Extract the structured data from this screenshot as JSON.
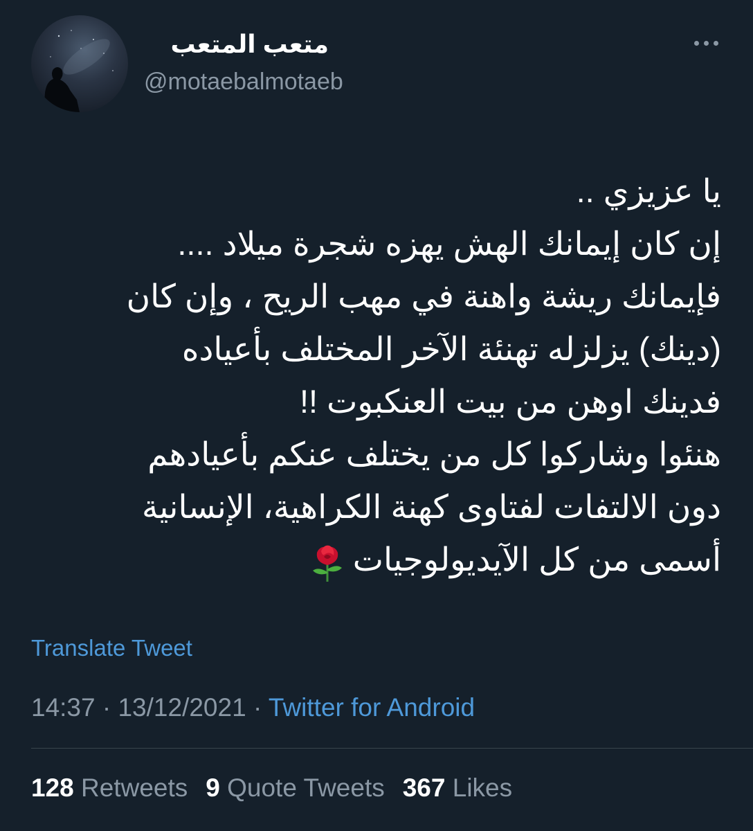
{
  "author": {
    "display_name": "متعب المتعب",
    "handle": "@motaebalmotaeb"
  },
  "tweet": {
    "lines": [
      "يا عزيزي ..",
      "إن كان إيمانك الهش يهزه شجرة ميلاد ....",
      "فإيمانك ريشة واهنة في مهب الريح ، وإن كان",
      "(دينك) يزلزله تهنئة الآخر المختلف بأعياده",
      "فدينك اوهن من بيت العنكبوت !!",
      "هنئوا وشاركوا كل من يختلف عنكم بأعيادهم",
      "دون الالتفات لفتاوى كهنة الكراهية، الإنسانية",
      "أسمى من كل الآيديولوجيات"
    ],
    "trailing_emoji": "rose-icon"
  },
  "translate_label": "Translate Tweet",
  "meta": {
    "time": "14:37",
    "separator": " · ",
    "date": "13/12/2021",
    "source": "Twitter for Android"
  },
  "stats": {
    "retweets_count": "128",
    "retweets_label": "Retweets",
    "quotes_count": "9",
    "quotes_label": "Quote Tweets",
    "likes_count": "367",
    "likes_label": "Likes"
  },
  "colors": {
    "background": "#15202b",
    "text": "#ffffff",
    "secondary": "#8b98a5",
    "link": "#4e99d9",
    "divider": "#38444d"
  }
}
